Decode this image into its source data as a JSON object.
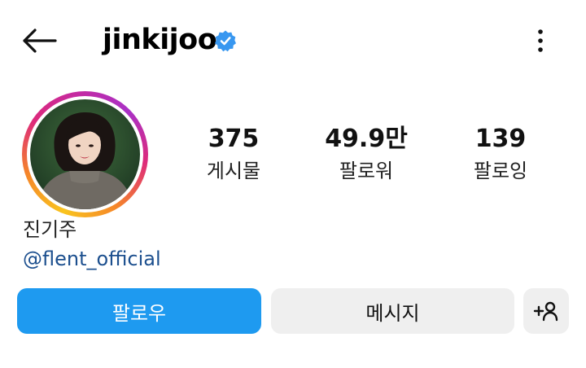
{
  "header": {
    "username": "jinkijoo",
    "back_icon": "arrow-left-icon",
    "verified_icon": "verified-badge-icon",
    "more_icon": "more-vertical-icon"
  },
  "profile": {
    "display_name": "진기주",
    "linked_handle": "@flent_official",
    "avatar": "profile-photo"
  },
  "stats": [
    {
      "value": "375",
      "label": "게시물"
    },
    {
      "value": "49.9만",
      "label": "팔로워"
    },
    {
      "value": "139",
      "label": "팔로잉"
    }
  ],
  "actions": {
    "follow_label": "팔로우",
    "message_label": "메시지",
    "suggest_icon": "add-person-icon"
  },
  "colors": {
    "primary_button": "#1e9af0",
    "secondary_button": "#efefef",
    "verified_badge": "#3897f0",
    "link": "#1c4f8e"
  }
}
